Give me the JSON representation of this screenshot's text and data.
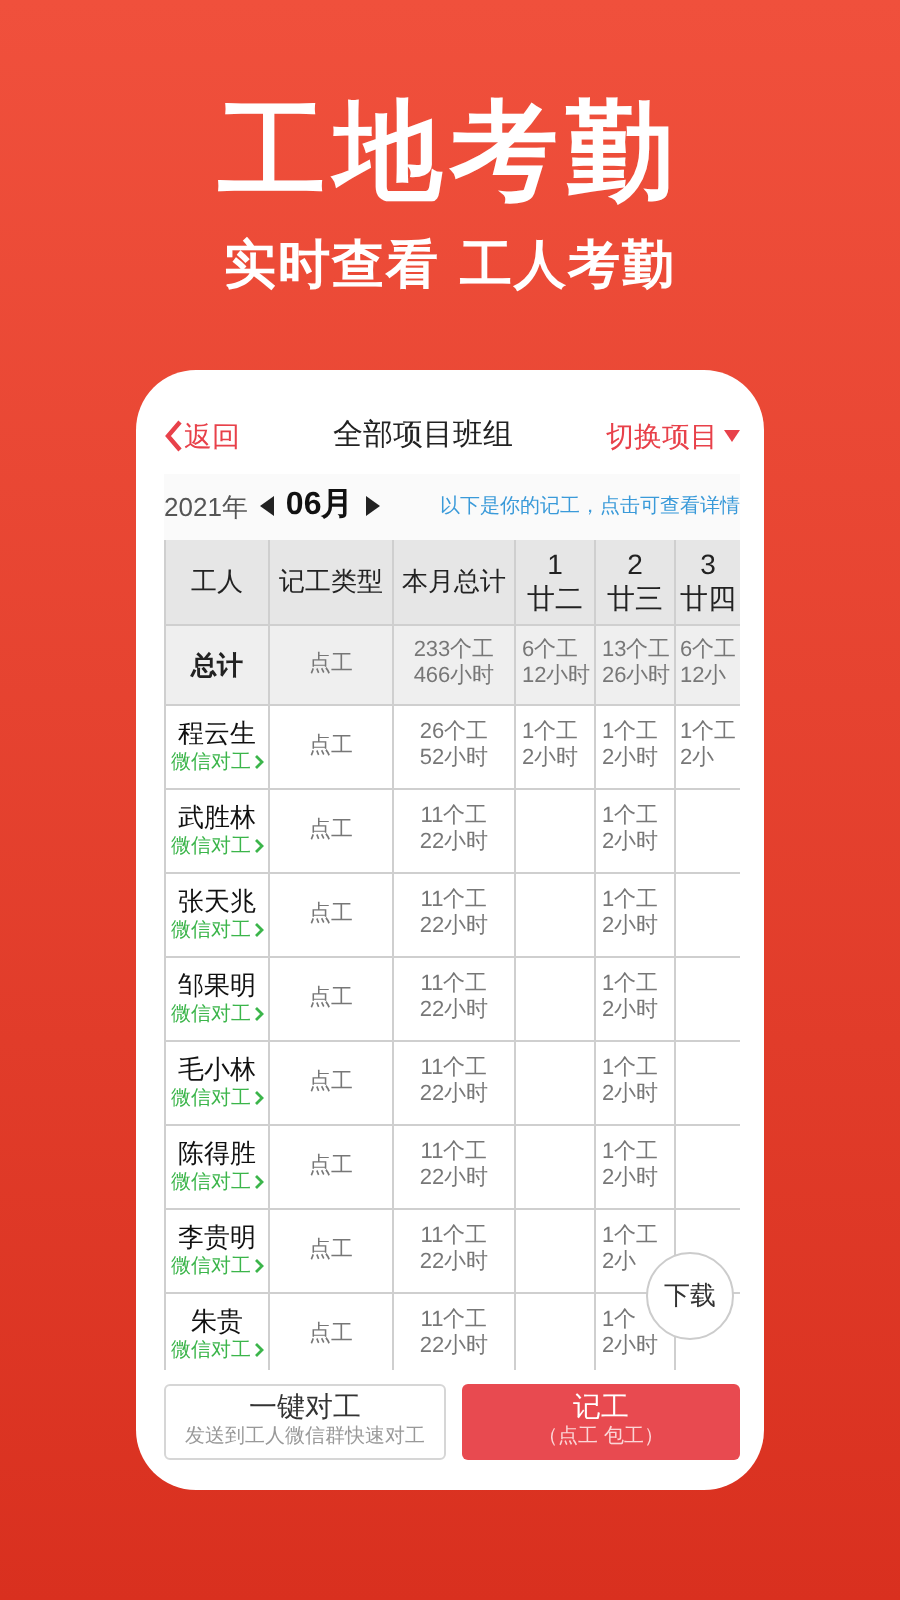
{
  "hero": {
    "title": "工地考勤",
    "subtitle": "实时查看 工人考勤"
  },
  "nav": {
    "back": "返回",
    "title": "全部项目班组",
    "switch": "切换项目"
  },
  "period": {
    "year": "2021年",
    "month": "06月",
    "hint": "以下是你的记工，点击可查看详情"
  },
  "table": {
    "columns": [
      {
        "label": "工人"
      },
      {
        "label": "记工类型"
      },
      {
        "label": "本月总计"
      },
      {
        "day": "1",
        "lunar": "廿二"
      },
      {
        "day": "2",
        "lunar": "廿三"
      },
      {
        "day": "3",
        "lunar": "廿四"
      }
    ],
    "total": {
      "cells": [
        "总计",
        "点工",
        "233个工\n466小时",
        "6个工\n12小时",
        "13个工\n26小时",
        "6个工\n12小"
      ]
    },
    "rows": [
      {
        "link": "微信对工",
        "cells": [
          "程云生",
          "点工",
          "26个工\n52小时",
          "1个工\n2小时",
          "1个工\n2小时",
          "1个工\n2小"
        ]
      },
      {
        "link": "微信对工",
        "cells": [
          "武胜林",
          "点工",
          "11个工\n22小时",
          "",
          "1个工\n2小时",
          ""
        ]
      },
      {
        "link": "微信对工",
        "cells": [
          "张天兆",
          "点工",
          "11个工\n22小时",
          "",
          "1个工\n2小时",
          ""
        ]
      },
      {
        "link": "微信对工",
        "cells": [
          "邹果明",
          "点工",
          "11个工\n22小时",
          "",
          "1个工\n2小时",
          ""
        ]
      },
      {
        "link": "微信对工",
        "cells": [
          "毛小林",
          "点工",
          "11个工\n22小时",
          "",
          "1个工\n2小时",
          ""
        ]
      },
      {
        "link": "微信对工",
        "cells": [
          "陈得胜",
          "点工",
          "11个工\n22小时",
          "",
          "1个工\n2小时",
          ""
        ]
      },
      {
        "link": "微信对工",
        "cells": [
          "李贵明",
          "点工",
          "11个工\n22小时",
          "",
          "1个工\n2小",
          ""
        ]
      },
      {
        "link": "微信对工",
        "cells": [
          "朱贵",
          "点工",
          "11个工\n22小时",
          "",
          "1个\n2小时",
          ""
        ]
      }
    ]
  },
  "download": "下载",
  "actions": [
    {
      "kind": "outline",
      "label": "一键对工",
      "sub": "发送到工人微信群快速对工"
    },
    {
      "kind": "primary",
      "label": "记工",
      "sub": "（点工 包工）"
    }
  ]
}
